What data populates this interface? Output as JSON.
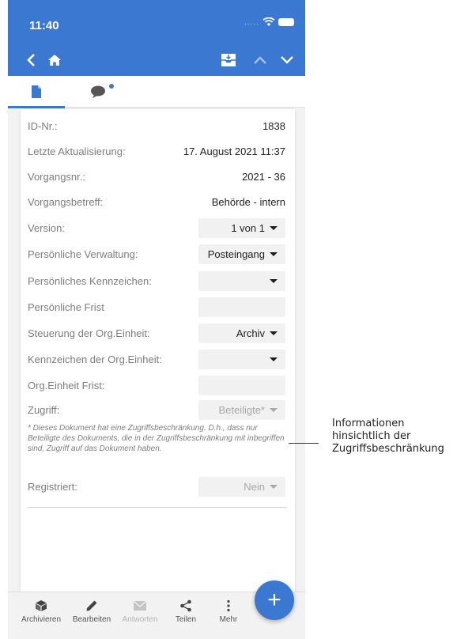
{
  "status_bar": {
    "time": "11:40",
    "signal": "....."
  },
  "nav_bar": {
    "icons": [
      "chevron-left-icon",
      "home-icon",
      "inbox-icon",
      "chevron-up-icon",
      "chevron-down-icon"
    ]
  },
  "tabs": [
    {
      "name": "document",
      "icon": "document-icon",
      "active": true
    },
    {
      "name": "comments",
      "icon": "comment-icon",
      "active": false,
      "has_notification": true
    }
  ],
  "details": {
    "id_label": "ID-Nr.:",
    "id_value": "1838",
    "updated_label": "Letzte Aktualisierung:",
    "updated_value": "17. August 2021 11:37",
    "case_no_label": "Vorgangsnr.:",
    "case_no_value": "2021 - 36",
    "case_subject_label": "Vorgangsbetreff:",
    "case_subject_value": "Behörde - intern",
    "version_label": "Version:",
    "version_value": "1 von 1",
    "personal_admin_label": "Persönliche Verwaltung:",
    "personal_admin_value": "Posteingang",
    "personal_mark_label": "Persönliches Kennzeichen:",
    "personal_mark_value": "",
    "personal_deadline_label": "Persönliche Frist",
    "personal_deadline_value": "",
    "org_control_label": "Steuerung der Org.Einheit:",
    "org_control_value": "Archiv",
    "org_mark_label": "Kennzeichen der Org.Einheit:",
    "org_mark_value": "",
    "org_deadline_label": "Org.Einheit Frist:",
    "org_deadline_value": "",
    "access_label": "Zugriff:",
    "access_value": "Beteiligte*",
    "access_note": "* Dieses Dokument hat eine Zugriffsbeschränkung. D.h., dass nur Beteiligte des Dokuments, die in der Zugriffsbeschränkung mit inbegriffen sind, Zugriff auf das Dokument haben.",
    "registered_label": "Registriert:",
    "registered_value": "Nein"
  },
  "bottom_bar": {
    "archive": "Archivieren",
    "edit": "Bearbeiten",
    "reply": "Antworten",
    "share": "Teilen",
    "more": "Mehr"
  },
  "fab_label": "+",
  "callout": {
    "line1": "Informationen",
    "line2": "hinsichtlich der",
    "line3": "Zugriffsbeschränkung"
  },
  "colors": {
    "accent": "#3a78d2",
    "background": "#f2f2f2",
    "label": "#7d7d7d",
    "disabled": "#a8a8a8"
  }
}
